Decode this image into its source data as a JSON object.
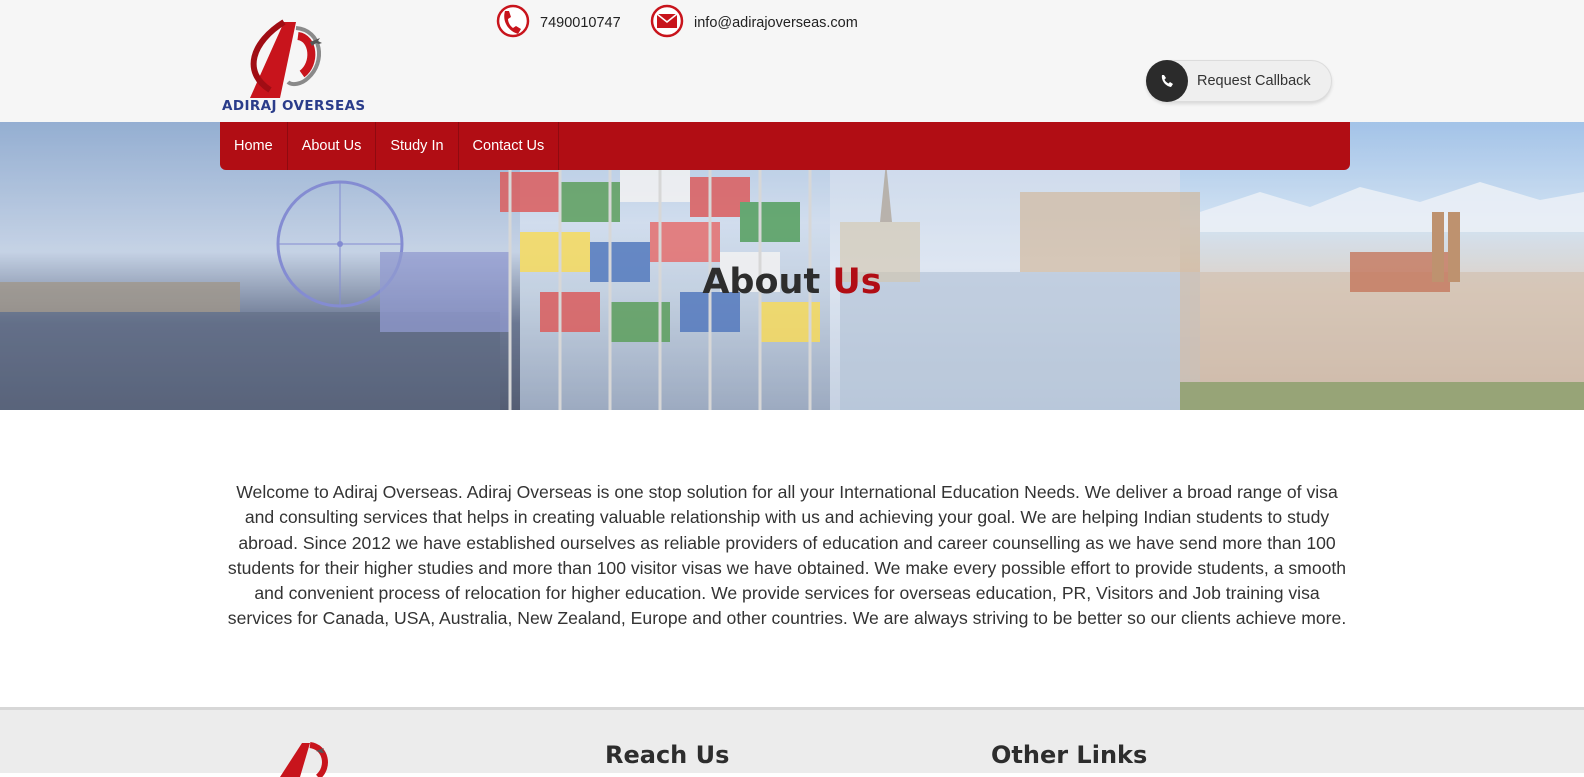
{
  "header": {
    "brand": "ADIRAJ OVERSEAS",
    "phone": "7490010747",
    "email": "info@adirajoverseas.com",
    "callback_label": "Request Callback",
    "icons": {
      "phone": "phone-icon",
      "email": "email-icon",
      "callback": "phone-icon"
    }
  },
  "nav": {
    "items": [
      {
        "label": "Home"
      },
      {
        "label": "About Us"
      },
      {
        "label": "Study In"
      },
      {
        "label": "Contact Us"
      }
    ]
  },
  "banner": {
    "title_main": "About",
    "title_accent": "Us"
  },
  "main": {
    "paragraph": "Welcome to Adiraj Overseas. Adiraj Overseas is one stop solution for all your International Education Needs. We deliver a broad range of visa and consulting services that helps in creating valuable relationship with us and achieving your goal. We are helping Indian students to study abroad. Since 2012 we have established ourselves as reliable providers of education and career counselling as we have send more than 100 students for their higher studies and more than 100 visitor visas we have obtained. We make every possible effort to provide students, a smooth and convenient process of relocation for higher education. We provide services for overseas education, PR, Visitors and Job training visa services for Canada, USA, Australia, New Zealand, Europe and other countries. We are always striving to be better so our clients achieve more."
  },
  "footer": {
    "reach_heading": "Reach Us",
    "links_heading": "Other Links"
  },
  "colors": {
    "brand_red": "#b10d14",
    "logo_blue": "#2a3c8a",
    "dark": "#2b2b2b"
  }
}
